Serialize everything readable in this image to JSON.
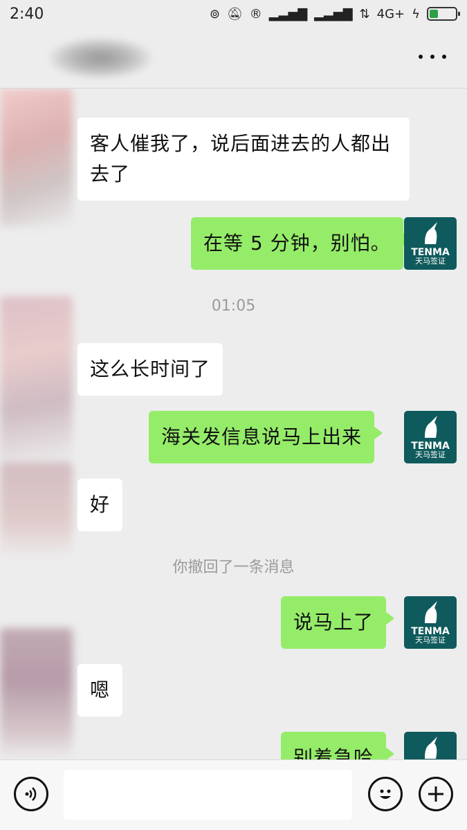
{
  "status_bar": {
    "time": "2:40",
    "network": "4G+"
  },
  "header": {
    "more_label": "···"
  },
  "messages": [
    {
      "side": "left",
      "text": "客人催我了，说后面进去的人都出去了"
    },
    {
      "side": "right",
      "text": "在等 5 分钟，别怕。"
    },
    {
      "type": "time",
      "text": "01:05"
    },
    {
      "side": "left",
      "text": "这么长时间了"
    },
    {
      "side": "right",
      "text": "海关发信息说马上出来"
    },
    {
      "side": "left",
      "text": "好"
    },
    {
      "type": "system",
      "text": "你撤回了一条消息"
    },
    {
      "side": "right",
      "text": "说马上了"
    },
    {
      "side": "left",
      "text": "嗯"
    },
    {
      "side": "right",
      "text": "别着急哈"
    }
  ],
  "avatar_right": {
    "brand": "TENMA",
    "brand_sub": "天马签证"
  },
  "input_bar": {
    "value": "",
    "voice_icon": "voice-icon",
    "emoji_icon": "emoji-icon",
    "plus_icon": "plus-icon"
  },
  "colors": {
    "bubble_right": "#95ec69",
    "bubble_left": "#ffffff",
    "background": "#ededed",
    "avatar_bg": "#0f5a5c"
  }
}
